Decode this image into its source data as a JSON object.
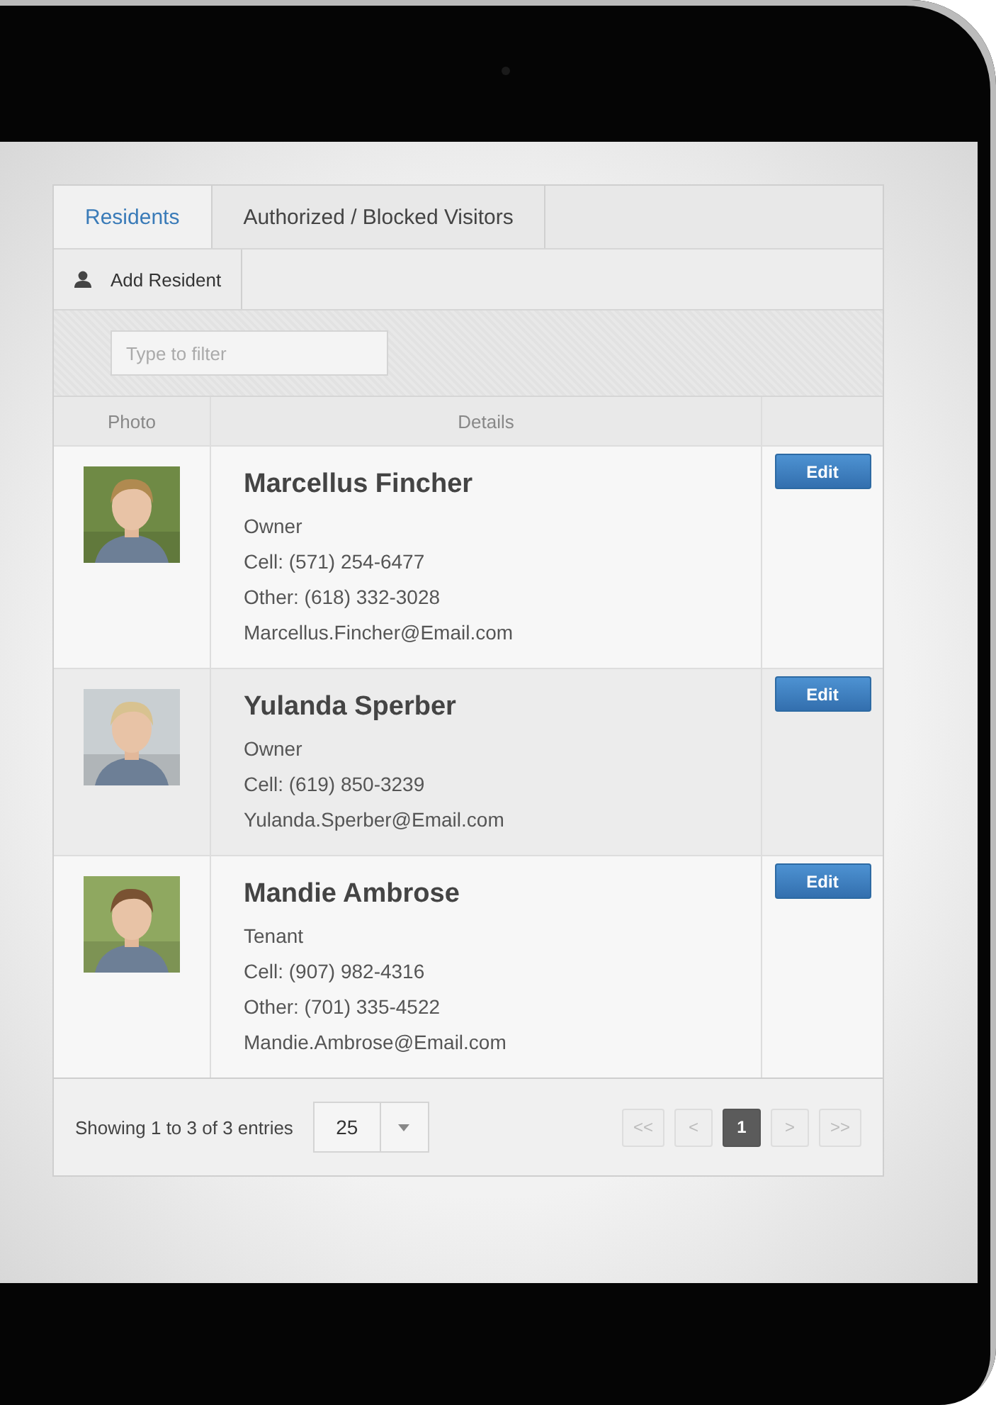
{
  "tabs": [
    {
      "label": "Residents",
      "selected": true
    },
    {
      "label": "Authorized / Blocked Visitors",
      "selected": false
    }
  ],
  "toolbar": {
    "add_button": "Add Resident"
  },
  "filter": {
    "placeholder": "Type to filter"
  },
  "table": {
    "columns": [
      "Photo",
      "Details"
    ],
    "rows": [
      {
        "name": "Marcellus Fincher",
        "role": "Owner",
        "lines": [
          "Cell: (571) 254-6477",
          "Other: (618) 332-3028",
          "Marcellus.Fincher@Email.com"
        ],
        "action": "Edit"
      },
      {
        "name": "Yulanda Sperber",
        "role": "Owner",
        "lines": [
          "Cell: (619) 850-3239",
          "Yulanda.Sperber@Email.com"
        ],
        "action": "Edit"
      },
      {
        "name": "Mandie Ambrose",
        "role": "Tenant",
        "lines": [
          "Cell: (907) 982-4316",
          "Other: (701) 335-4522",
          "Mandie.Ambrose@Email.com"
        ],
        "action": "Edit"
      }
    ]
  },
  "footer": {
    "info": "Showing 1 to 3 of 3 entries",
    "page_size": "25",
    "pages": [
      {
        "label": "<<",
        "selected": false,
        "disabled": true
      },
      {
        "label": "<",
        "selected": false,
        "disabled": true
      },
      {
        "label": "1",
        "selected": true,
        "disabled": false
      },
      {
        "label": ">",
        "selected": false,
        "disabled": true
      },
      {
        "label": ">>",
        "selected": false,
        "disabled": true
      }
    ]
  }
}
